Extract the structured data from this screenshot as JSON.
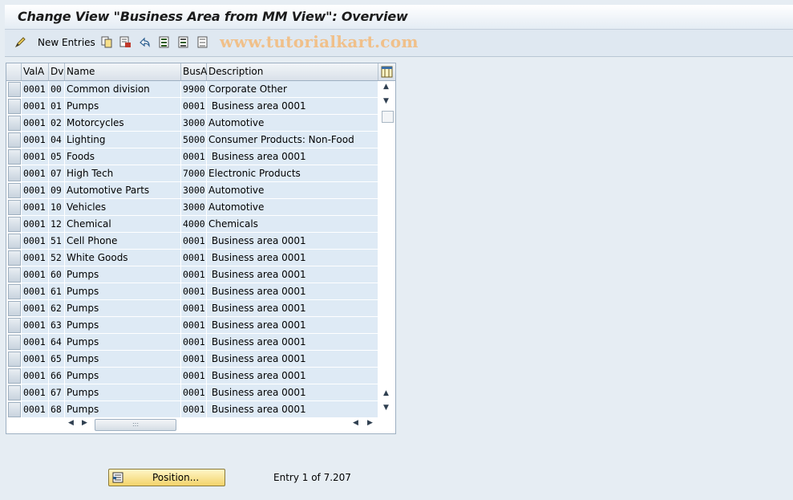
{
  "window": {
    "title": "Change View \"Business Area from MM View\": Overview"
  },
  "toolbar": {
    "new_entries_label": "New Entries",
    "watermark": "www.tutorialkart.com",
    "icons": [
      "display-change-icon",
      "copy-icon",
      "delete-icon",
      "undo-icon",
      "select-all-icon",
      "select-block-icon",
      "deselect-all-icon"
    ]
  },
  "table": {
    "columns": [
      "ValA",
      "Dv",
      "Name",
      "BusA",
      "Description"
    ],
    "rows": [
      {
        "vala": "0001",
        "dv": "00",
        "name": "Common division",
        "busa": "9900",
        "desc": "Corporate Other"
      },
      {
        "vala": "0001",
        "dv": "01",
        "name": "Pumps",
        "busa": "0001",
        "desc": " Business area 0001"
      },
      {
        "vala": "0001",
        "dv": "02",
        "name": "Motorcycles",
        "busa": "3000",
        "desc": "Automotive"
      },
      {
        "vala": "0001",
        "dv": "04",
        "name": "Lighting",
        "busa": "5000",
        "desc": "Consumer Products: Non-Food"
      },
      {
        "vala": "0001",
        "dv": "05",
        "name": "Foods",
        "busa": "0001",
        "desc": " Business area 0001"
      },
      {
        "vala": "0001",
        "dv": "07",
        "name": "High Tech",
        "busa": "7000",
        "desc": "Electronic Products"
      },
      {
        "vala": "0001",
        "dv": "09",
        "name": "Automotive Parts",
        "busa": "3000",
        "desc": "Automotive"
      },
      {
        "vala": "0001",
        "dv": "10",
        "name": "Vehicles",
        "busa": "3000",
        "desc": "Automotive"
      },
      {
        "vala": "0001",
        "dv": "12",
        "name": "Chemical",
        "busa": "4000",
        "desc": "Chemicals"
      },
      {
        "vala": "0001",
        "dv": "51",
        "name": "Cell Phone",
        "busa": "0001",
        "desc": " Business area 0001"
      },
      {
        "vala": "0001",
        "dv": "52",
        "name": "White Goods",
        "busa": "0001",
        "desc": " Business area 0001"
      },
      {
        "vala": "0001",
        "dv": "60",
        "name": "Pumps",
        "busa": "0001",
        "desc": " Business area 0001"
      },
      {
        "vala": "0001",
        "dv": "61",
        "name": "Pumps",
        "busa": "0001",
        "desc": " Business area 0001"
      },
      {
        "vala": "0001",
        "dv": "62",
        "name": "Pumps",
        "busa": "0001",
        "desc": " Business area 0001"
      },
      {
        "vala": "0001",
        "dv": "63",
        "name": "Pumps",
        "busa": "0001",
        "desc": " Business area 0001"
      },
      {
        "vala": "0001",
        "dv": "64",
        "name": "Pumps",
        "busa": "0001",
        "desc": " Business area 0001"
      },
      {
        "vala": "0001",
        "dv": "65",
        "name": "Pumps",
        "busa": "0001",
        "desc": " Business area 0001"
      },
      {
        "vala": "0001",
        "dv": "66",
        "name": "Pumps",
        "busa": "0001",
        "desc": " Business area 0001"
      },
      {
        "vala": "0001",
        "dv": "67",
        "name": "Pumps",
        "busa": "0001",
        "desc": " Business area 0001"
      },
      {
        "vala": "0001",
        "dv": "68",
        "name": "Pumps",
        "busa": "0001",
        "desc": " Business area 0001"
      }
    ]
  },
  "footer": {
    "position_button_label": "Position...",
    "entry_info": "Entry 1 of 7.207"
  }
}
